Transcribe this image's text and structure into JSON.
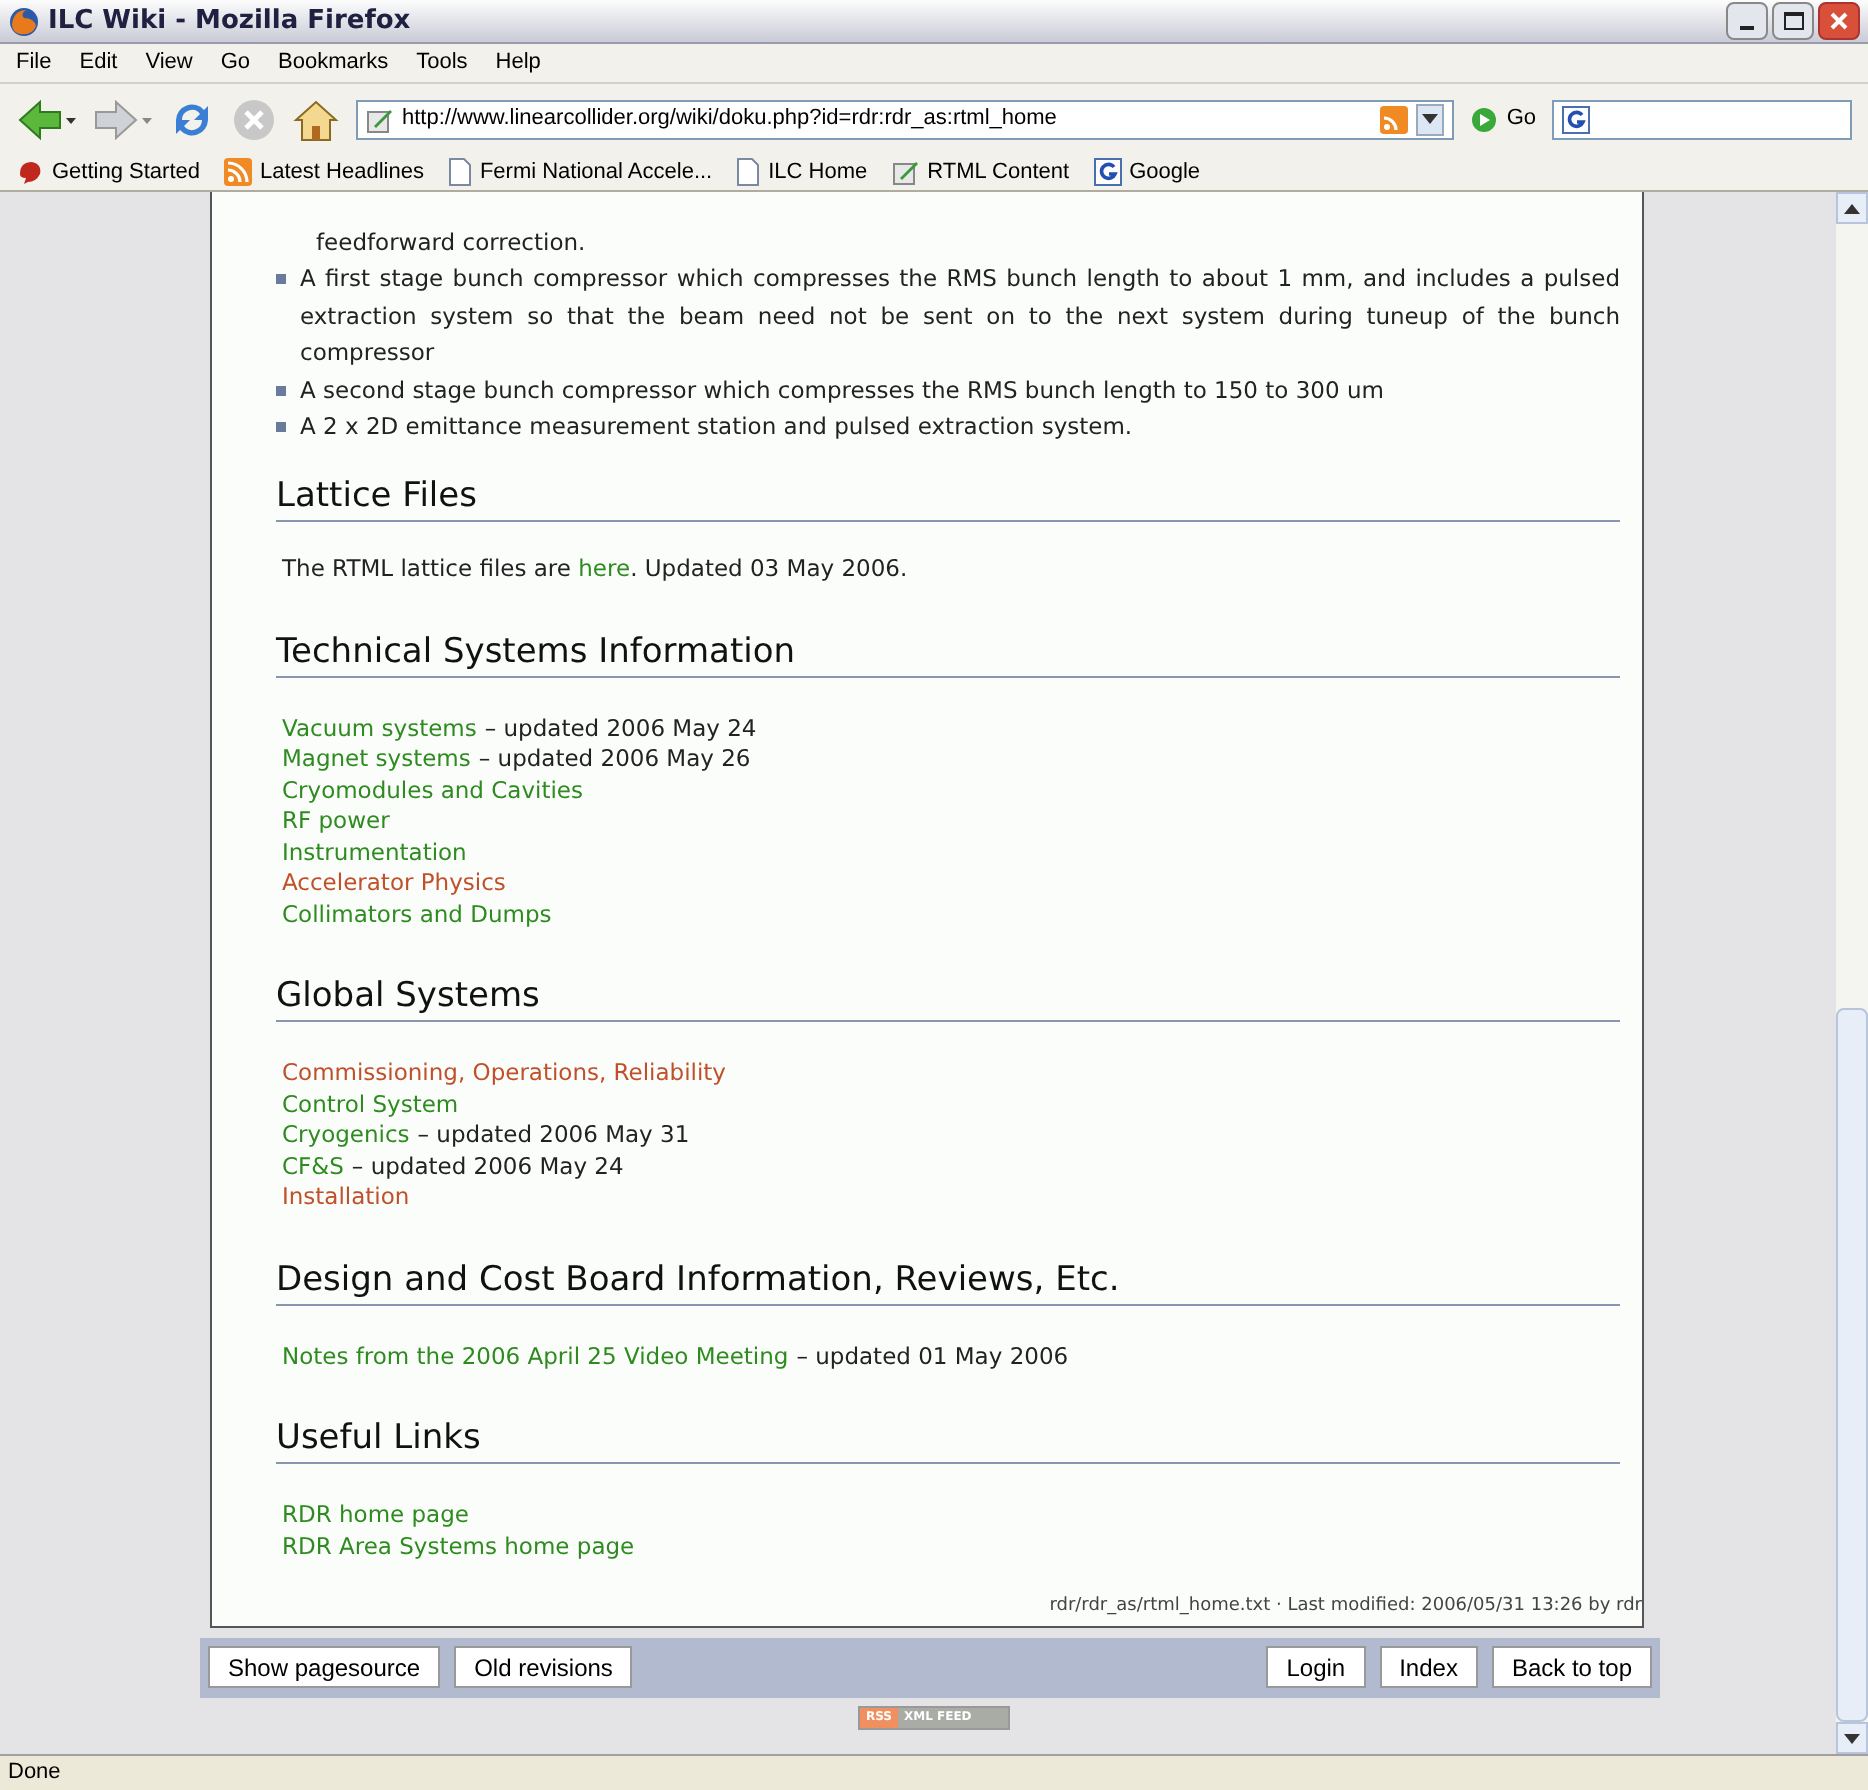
{
  "window": {
    "title": "ILC Wiki - Mozilla Firefox"
  },
  "menu": [
    "File",
    "Edit",
    "View",
    "Go",
    "Bookmarks",
    "Tools",
    "Help"
  ],
  "address": {
    "value": "http://www.linearcollider.org/wiki/doku.php?id=rdr:rdr_as:rtml_home",
    "go": "Go"
  },
  "bookmarks": [
    {
      "label": "Getting Started",
      "kind": "start"
    },
    {
      "label": "Latest Headlines",
      "kind": "feed"
    },
    {
      "label": "Fermi National Accele...",
      "kind": "page"
    },
    {
      "label": "ILC Home",
      "kind": "page"
    },
    {
      "label": "RTML Content",
      "kind": "tool"
    },
    {
      "label": "Google",
      "kind": "google"
    }
  ],
  "page": {
    "intro": "feedforward correction.",
    "bullets": [
      "A first stage bunch compressor which compresses the RMS bunch length to about 1 mm, and includes a pulsed extraction system so that the beam need not be sent on to the next system during tuneup of the bunch compressor",
      "A second stage bunch compressor which compresses the RMS bunch length to 150 to 300 um",
      "A 2 x 2D emittance measurement station and pulsed extraction system."
    ],
    "sections": [
      {
        "heading": "Lattice Files",
        "kind": "paragraph",
        "before": "The RTML lattice files are ",
        "link": "here",
        "after": ". Updated 03 May 2006."
      },
      {
        "heading": "Technical Systems Information",
        "kind": "list",
        "items": [
          {
            "link": "Vacuum systems",
            "exists": true,
            "note": "– updated 2006 May 24"
          },
          {
            "link": "Magnet systems",
            "exists": true,
            "note": "– updated 2006 May 26"
          },
          {
            "link": "Cryomodules and Cavities",
            "exists": true
          },
          {
            "link": "RF power",
            "exists": true
          },
          {
            "link": "Instrumentation",
            "exists": true
          },
          {
            "link": "Accelerator Physics",
            "exists": false
          },
          {
            "link": "Collimators and Dumps",
            "exists": true
          }
        ]
      },
      {
        "heading": "Global Systems",
        "kind": "list",
        "items": [
          {
            "link": "Commissioning, Operations, Reliability",
            "exists": false
          },
          {
            "link": "Control System",
            "exists": true
          },
          {
            "link": "Cryogenics",
            "exists": true,
            "note": "– updated 2006 May 31"
          },
          {
            "link": "CF&S",
            "exists": true,
            "note": "– updated 2006 May 24"
          },
          {
            "link": "Installation",
            "exists": false
          }
        ]
      },
      {
        "heading": "Design and Cost Board Information, Reviews, Etc.",
        "kind": "list",
        "items": [
          {
            "link": "Notes from the 2006 April 25 Video Meeting",
            "exists": true,
            "note": "– updated 01 May 2006"
          }
        ]
      },
      {
        "heading": "Useful Links",
        "kind": "list",
        "items": [
          {
            "link": "RDR home page",
            "exists": true
          },
          {
            "link": "RDR Area Systems home page",
            "exists": true
          }
        ]
      }
    ],
    "meta": "rdr/rdr_as/rtml_home.txt · Last modified: 2006/05/31 13:26 by rdr"
  },
  "footer": {
    "left": [
      "Show pagesource",
      "Old revisions"
    ],
    "right": [
      "Login",
      "Index",
      "Back to top"
    ],
    "rss": "RSS",
    "feed": "XML FEED"
  },
  "status": "Done"
}
